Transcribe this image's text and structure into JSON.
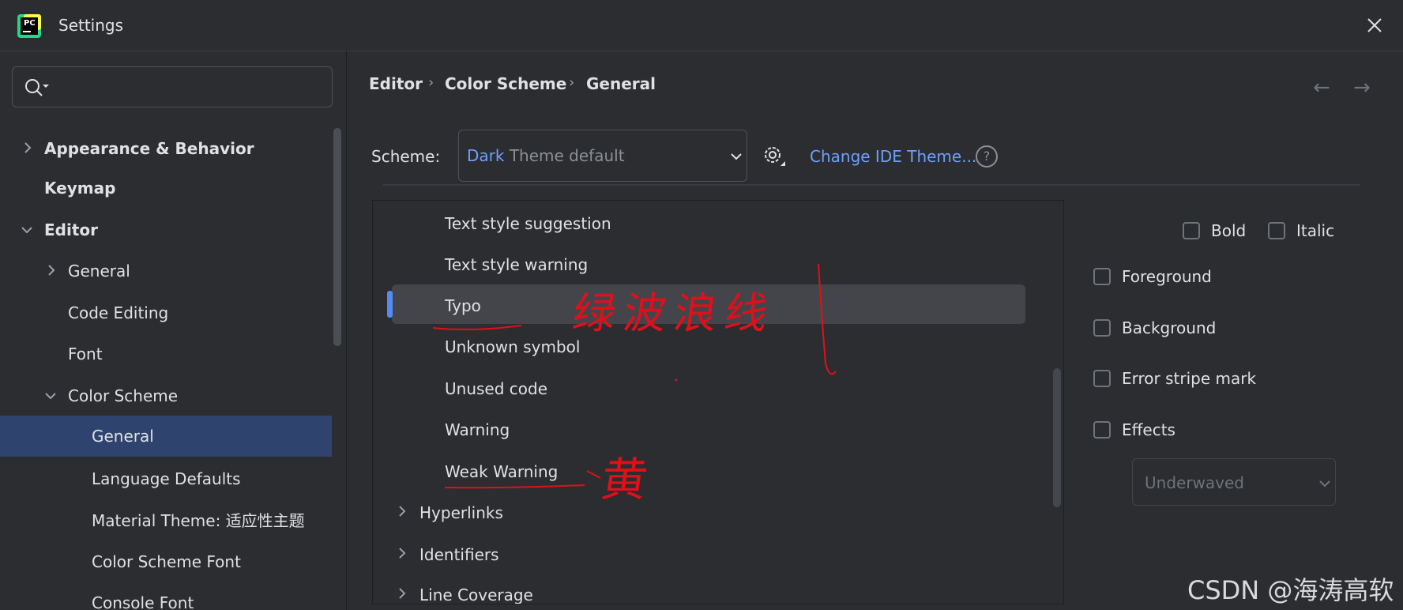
{
  "window": {
    "title": "Settings",
    "app_icon_text": "PC"
  },
  "search": {
    "value": "",
    "placeholder": ""
  },
  "sidebar": {
    "items": [
      {
        "label": "Appearance & Behavior"
      },
      {
        "label": "Keymap"
      },
      {
        "label": "Editor"
      },
      {
        "label": "General"
      },
      {
        "label": "Code Editing"
      },
      {
        "label": "Font"
      },
      {
        "label": "Color Scheme"
      },
      {
        "label": "General"
      },
      {
        "label": "Language Defaults"
      },
      {
        "label": "Material Theme: 适应性主题"
      },
      {
        "label": "Color Scheme Font"
      },
      {
        "label": "Console Font"
      }
    ]
  },
  "breadcrumb": [
    "Editor",
    "Color Scheme",
    "General"
  ],
  "scheme": {
    "label": "Scheme:",
    "value_accent": "Dark",
    "value_rest": " Theme default",
    "change_theme_link": "Change IDE Theme...",
    "help": "?"
  },
  "tree": {
    "items": [
      {
        "label": "Text style suggestion"
      },
      {
        "label": "Text style warning"
      },
      {
        "label": "Typo"
      },
      {
        "label": "Unknown symbol"
      },
      {
        "label": "Unused code"
      },
      {
        "label": "Warning"
      },
      {
        "label": "Weak Warning"
      },
      {
        "label": "Hyperlinks"
      },
      {
        "label": "Identifiers"
      },
      {
        "label": "Line Coverage"
      }
    ],
    "selected": "Typo"
  },
  "options": {
    "bold": "Bold",
    "italic": "Italic",
    "foreground": "Foreground",
    "background": "Background",
    "error_stripe": "Error stripe mark",
    "effects": "Effects",
    "effect_type": "Underwaved"
  },
  "annotations": {
    "typo_note": "绿波浪线",
    "weak_warning_note": "黄"
  },
  "watermark": "CSDN @海涛高软",
  "colors": {
    "accent": "#6f9fff",
    "selection": "#2e436e",
    "annotation": "#e0101a"
  }
}
